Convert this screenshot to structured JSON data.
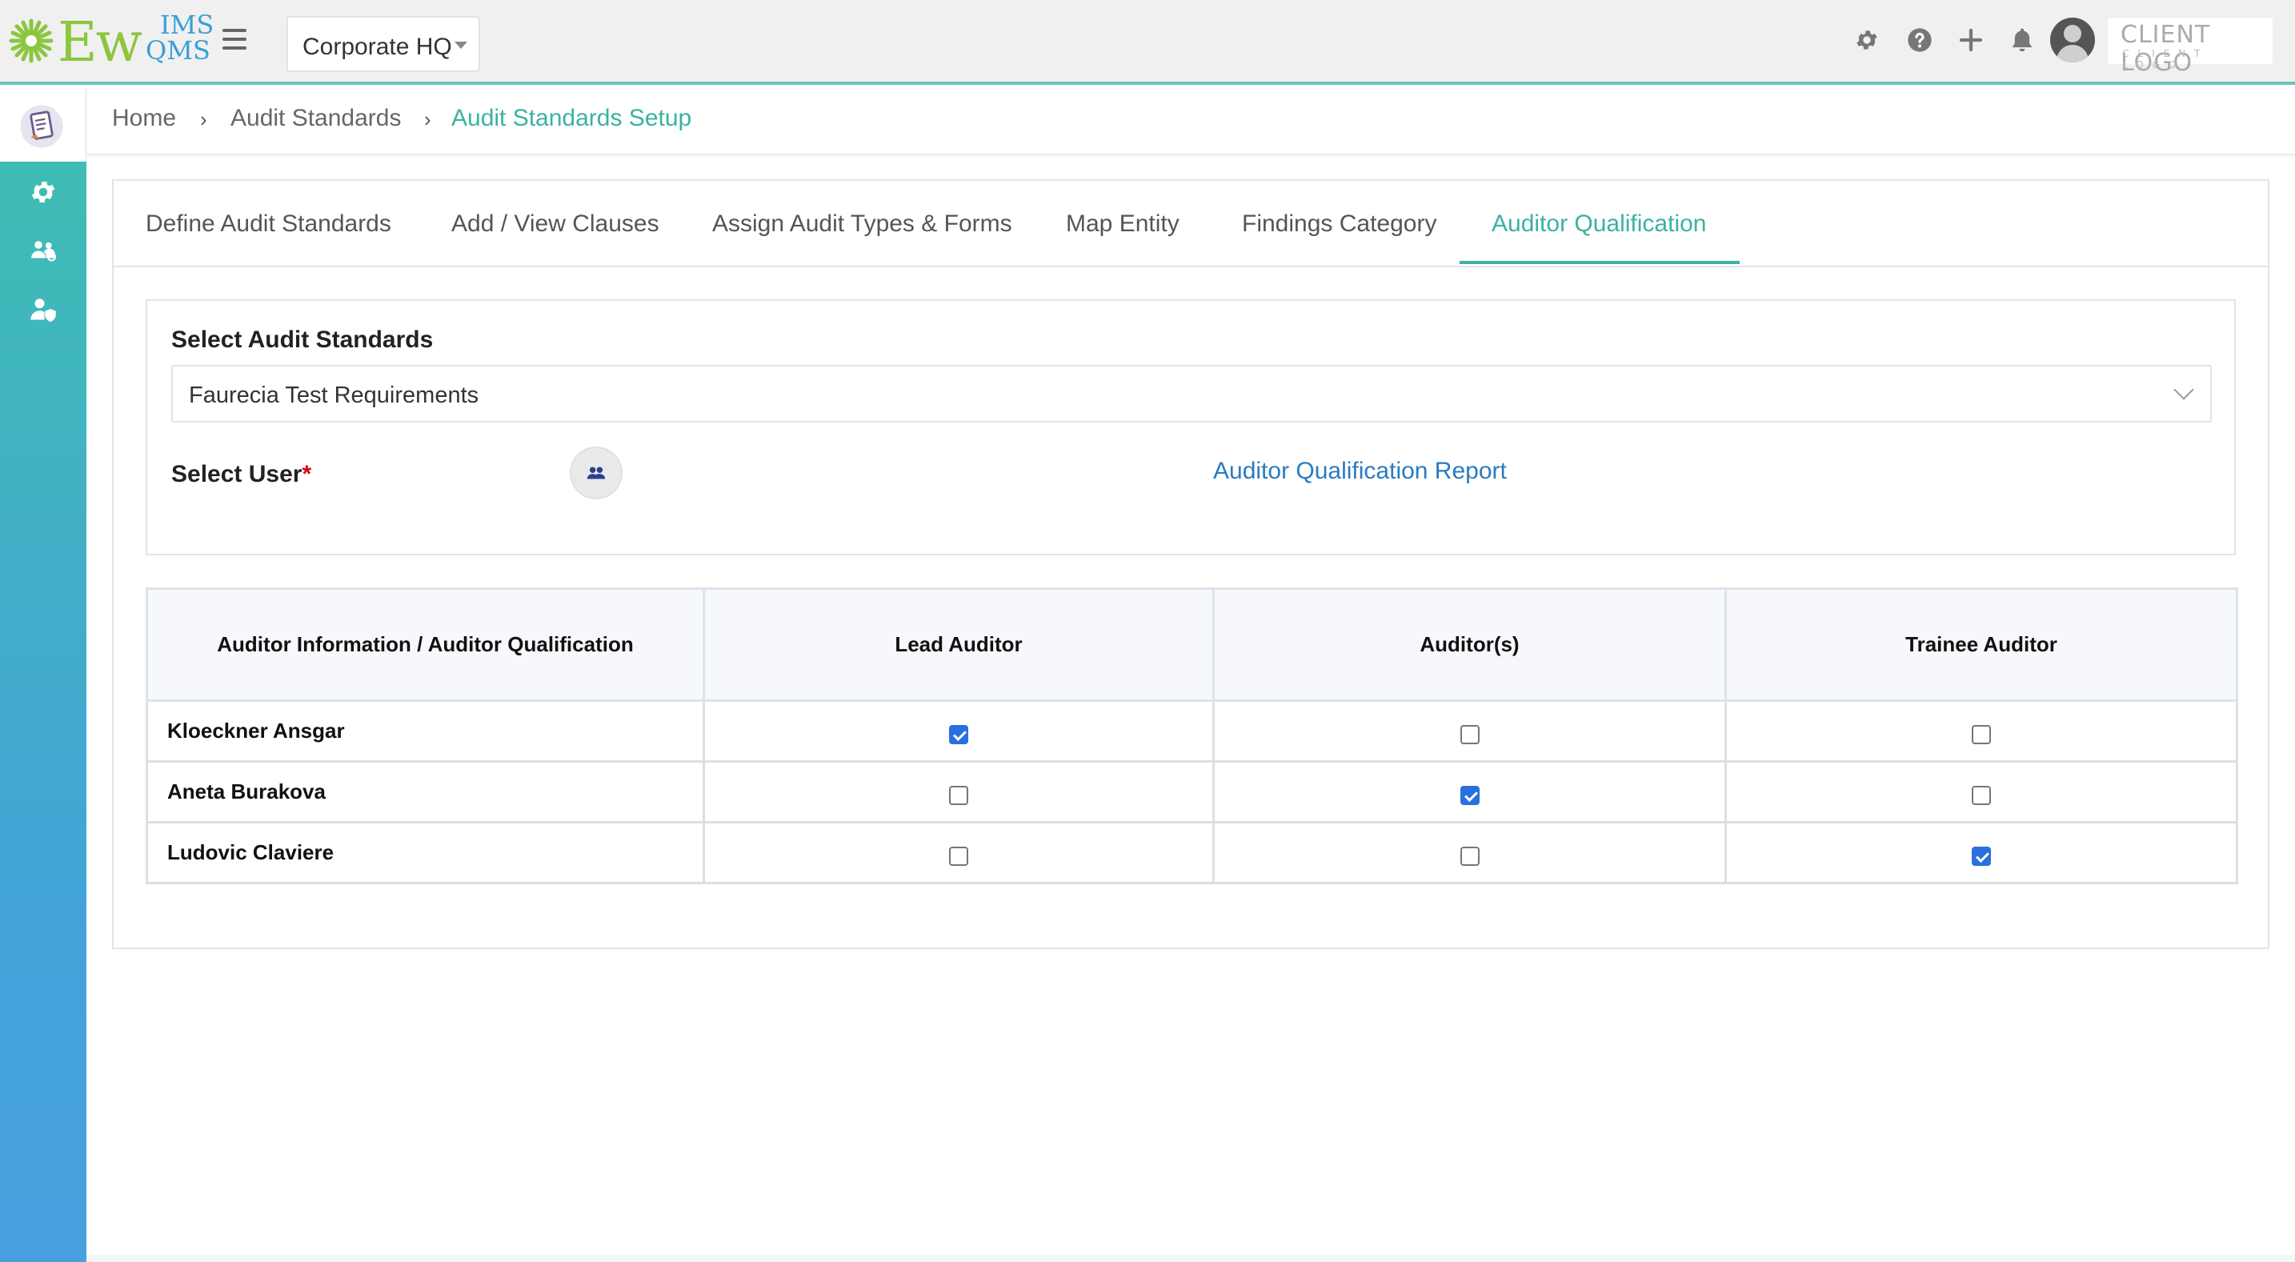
{
  "header": {
    "logo_text": "Ew",
    "logo_sup": "IMS",
    "logo_sub": "QMS",
    "site_selected": "Corporate HQ",
    "client_logo_main": "CLIENT LOGO",
    "client_logo_sub": "CLIENT LOGO",
    "icons": [
      "gear-icon",
      "help-icon",
      "plus-icon",
      "bell-icon"
    ]
  },
  "sidebar": {
    "icons": [
      "audit-document-icon",
      "settings-gear-icon",
      "users-group-icon",
      "user-shield-icon"
    ]
  },
  "breadcrumb": {
    "items": [
      "Home",
      "Audit Standards",
      "Audit Standards Setup"
    ]
  },
  "tabs": [
    "Define Audit Standards",
    "Add / View Clauses",
    "Assign Audit Types & Forms",
    "Map Entity",
    "Findings Category",
    "Auditor Qualification"
  ],
  "active_tab": "Auditor Qualification",
  "form": {
    "standards_label": "Select Audit Standards",
    "standards_value": "Faurecia Test Requirements",
    "user_label": "Select User",
    "required_mark": "*",
    "report_link": "Auditor Qualification Report"
  },
  "table": {
    "headers": [
      "Auditor Information / Auditor Qualification",
      "Lead Auditor",
      "Auditor(s)",
      "Trainee Auditor"
    ],
    "rows": [
      {
        "name": "Kloeckner Ansgar",
        "lead": true,
        "auditor": false,
        "trainee": false
      },
      {
        "name": "Aneta Burakova",
        "lead": false,
        "auditor": true,
        "trainee": false
      },
      {
        "name": "Ludovic Claviere",
        "lead": false,
        "auditor": false,
        "trainee": true
      }
    ]
  },
  "colors": {
    "accent": "#3bb2a0",
    "link": "#2a7bc0",
    "checkbox_checked": "#2a6fe0",
    "required": "#d0021b"
  }
}
